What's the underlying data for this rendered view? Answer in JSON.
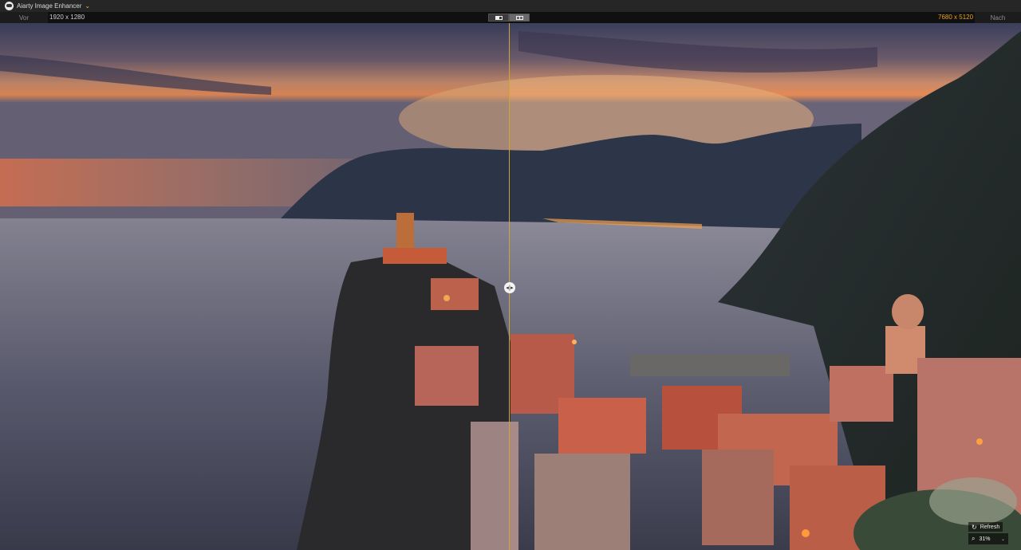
{
  "app": {
    "title": "Aiarty Image Enhancer",
    "title_chevron": "⌄",
    "accent": "#e8b931"
  },
  "toolbar": {
    "before_label": "Vor",
    "before_resolution": "1920 x 1280",
    "after_resolution": "7680 x 5120",
    "after_label": "Nach",
    "view_modes": [
      "single-view",
      "split-view"
    ],
    "active_view_mode": "split-view"
  },
  "canvas": {
    "divider_color": "#c9a635",
    "handle_glyph": "◂|▸"
  },
  "controls": {
    "refresh_label": "Refresh",
    "refresh_icon": "↻",
    "zoom_icon": "⌕",
    "zoom_value": "31%",
    "zoom_chevron": "⌄"
  }
}
